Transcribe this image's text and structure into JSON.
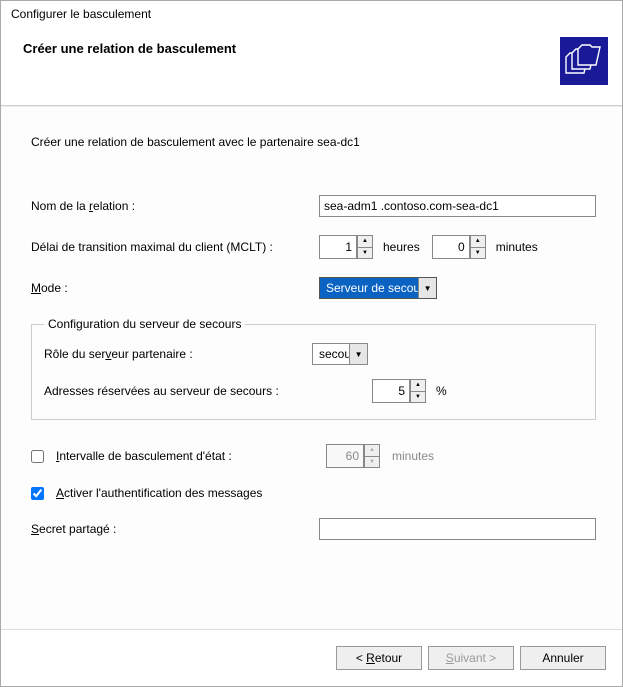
{
  "window": {
    "title": "Configurer le basculement"
  },
  "header": {
    "title": "Créer une relation de basculement"
  },
  "intro": "Créer une relation de basculement avec le partenaire sea-dc1",
  "labels": {
    "relation_name": "Nom de la relation :",
    "mclt": "Délai de transition maximal du client (MCLT) :",
    "hours": "heures",
    "minutes": "minutes",
    "mode": "Mode :",
    "mode_key": "M",
    "groupbox": "Configuration du serveur de secours",
    "partner_role": "Rôle du serveur partenaire :",
    "partner_role_key": "v",
    "reserved_addr": "Adresses réservées au serveur de secours :",
    "percent": "%",
    "state_interval": "Intervalle de basculement d'état :",
    "state_interval_key": "I",
    "enable_auth": "Activer l'authentification des messages",
    "enable_auth_key": "A",
    "shared_secret": "Secret partagé :",
    "shared_secret_key": "S"
  },
  "values": {
    "relation_name": "sea-adm1 .contoso.com-sea-dc1",
    "mclt_hours": "1",
    "mclt_minutes": "0",
    "mode": "Serveur de secours",
    "partner_role": "secours",
    "reserved_pct": "5",
    "state_interval_min": "60",
    "state_interval_checked": false,
    "enable_auth_checked": true,
    "shared_secret": ""
  },
  "buttons": {
    "back": "< Retour",
    "back_key": "R",
    "next": "Suivant >",
    "next_key": "S",
    "cancel": "Annuler"
  }
}
